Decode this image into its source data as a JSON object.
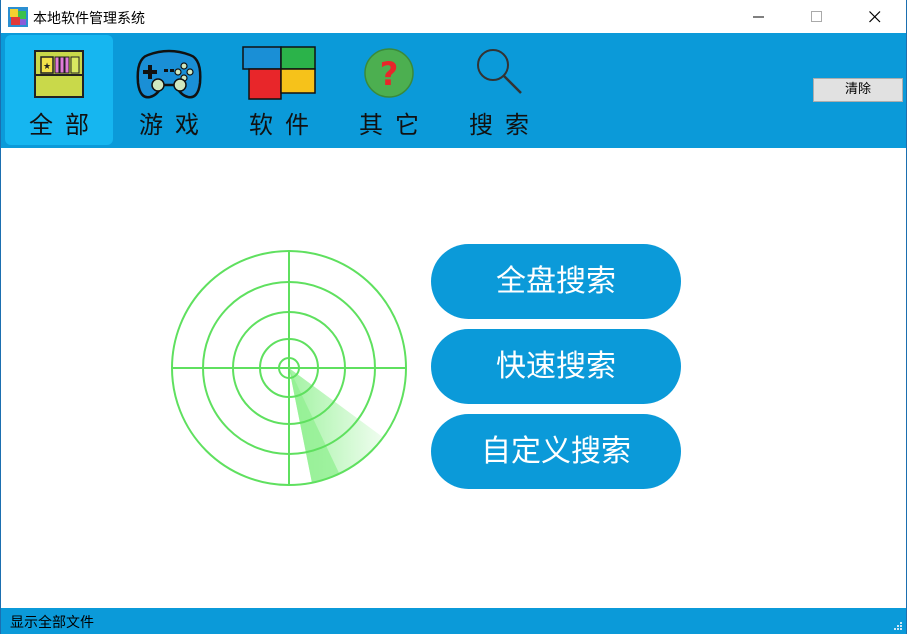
{
  "window": {
    "title": "本地软件管理系统",
    "controls": {
      "minimize": "—",
      "maximize": "☐",
      "close": "✕"
    }
  },
  "toolbar": {
    "items": [
      {
        "label": "全部",
        "icon": "all-files-icon",
        "active": true
      },
      {
        "label": "游戏",
        "icon": "gamepad-icon",
        "active": false
      },
      {
        "label": "软件",
        "icon": "software-blocks-icon",
        "active": false
      },
      {
        "label": "其它",
        "icon": "question-icon",
        "active": false
      },
      {
        "label": "搜索",
        "icon": "search-icon",
        "active": false
      }
    ],
    "clear_label": "清除"
  },
  "main": {
    "radar_icon": "radar-icon",
    "buttons": [
      {
        "label": "全盘搜索"
      },
      {
        "label": "快速搜索"
      },
      {
        "label": "自定义搜索"
      }
    ]
  },
  "status": {
    "text": "显示全部文件"
  },
  "colors": {
    "accent": "#0b9ad9",
    "active_tab": "#16b6f0",
    "radar_green": "#5fe05f"
  }
}
